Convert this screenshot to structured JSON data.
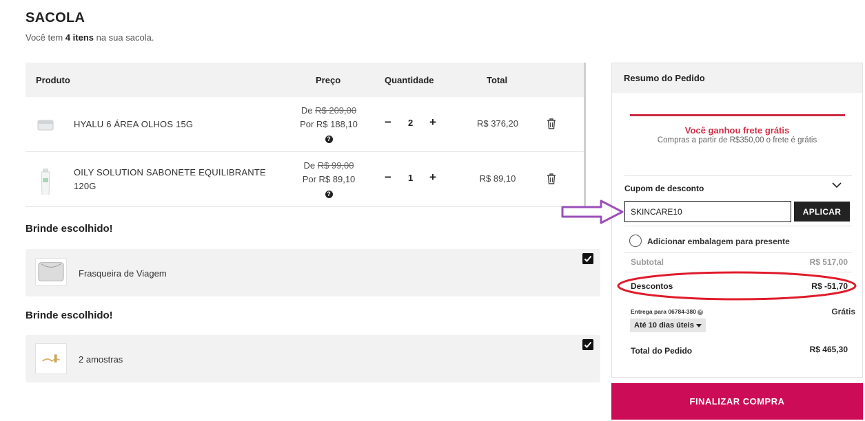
{
  "page": {
    "title": "SACOLA",
    "subtitle_prefix": "Você tem ",
    "subtitle_count": "4 itens",
    "subtitle_suffix": " na sua sacola."
  },
  "cart": {
    "headers": {
      "product": "Produto",
      "price": "Preço",
      "quantity": "Quantidade",
      "total": "Total"
    },
    "items": [
      {
        "name": "HYALU 6 ÁREA OLHOS 15G",
        "from_label": "De ",
        "from_price": "R$ 209,00",
        "by_price": "Por R$ 188,10",
        "qty": "2",
        "total": "R$ 376,20"
      },
      {
        "name": "OILY SOLUTION SABONETE EQUILIBRANTE 120G",
        "from_label": "De ",
        "from_price": "R$ 99,00",
        "by_price": "Por R$ 89,10",
        "qty": "1",
        "total": "R$ 89,10"
      }
    ],
    "minus": "−",
    "plus": "+"
  },
  "gifts": [
    {
      "title": "Brinde escolhido!",
      "name": "Frasqueira de Viagem",
      "checked": true
    },
    {
      "title": "Brinde escolhido!",
      "name": "2 amostras",
      "checked": true
    }
  ],
  "summary": {
    "title": "Resumo do Pedido",
    "shipping_title": "Você ganhou frete grátis",
    "shipping_sub": "Compras a partir de R$350,00 o frete é grátis",
    "coupon_label": "Cupom de desconto",
    "coupon_value": "SKINCARE10",
    "apply_label": "APLICAR",
    "gift_wrap_label": "Adicionar embalagem para presente",
    "subtotal_label": "Subtotal",
    "subtotal_value": "R$ 517,00",
    "discount_label": "Descontos",
    "discount_value": "R$ -51,70",
    "delivery_label": "Entrega para 06784-380",
    "delivery_value": "Grátis",
    "delivery_option": "Até 10 dias úteis",
    "total_label": "Total do Pedido",
    "total_value": "R$ 465,30"
  },
  "checkout_label": "FINALIZAR COMPRA",
  "colors": {
    "accent": "#cc0c56",
    "shipping_red": "#d03049",
    "annotation_purple": "#9b4fb8",
    "annotation_red": "#e01b2c"
  }
}
